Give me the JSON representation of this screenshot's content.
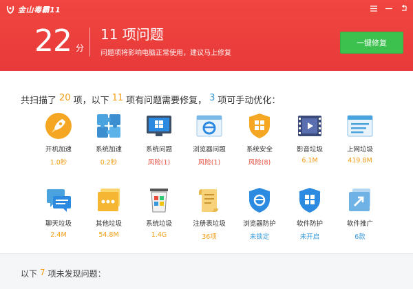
{
  "app": {
    "name": "金山毒霸11"
  },
  "header": {
    "score": "22",
    "score_unit": "分",
    "problem_title": "11 项问题",
    "problem_subtitle": "问题项将影响电脑正常使用，建议马上修复",
    "fix_button": "一键修复"
  },
  "summary": {
    "p1": "共扫描了",
    "scanned": "20",
    "p2": "项，以下",
    "issues": "11",
    "p3": "项有问题需要修复，",
    "manual": "3",
    "p4": "项可手动优化："
  },
  "colors": {
    "risk": "#e74c3c",
    "size": "#f39c12",
    "blue": "#3498db",
    "header": "#ed4040",
    "button": "#3cc14e"
  },
  "items": [
    {
      "label": "开机加速",
      "value": "1.0秒",
      "icon": "rocket-icon",
      "color": "#f39c12"
    },
    {
      "label": "系统加速",
      "value": "0.2秒",
      "icon": "puzzle-icon",
      "color": "#f39c12"
    },
    {
      "label": "系统问题",
      "value": "风险(1)",
      "icon": "windows-monitor-icon",
      "color": "#e74c3c"
    },
    {
      "label": "浏览器问题",
      "value": "风险(1)",
      "icon": "ie-browser-icon",
      "color": "#e74c3c"
    },
    {
      "label": "系统安全",
      "value": "风险(8)",
      "icon": "windows-shield-icon",
      "color": "#e74c3c"
    },
    {
      "label": "影音垃圾",
      "value": "6.1M",
      "icon": "film-icon",
      "color": "#f39c12"
    },
    {
      "label": "上网垃圾",
      "value": "419.8M",
      "icon": "web-page-icon",
      "color": "#f39c12"
    },
    {
      "label": "聊天垃圾",
      "value": "2.4M",
      "icon": "chat-icon",
      "color": "#f39c12"
    },
    {
      "label": "其他垃圾",
      "value": "54.8M",
      "icon": "dots-box-icon",
      "color": "#f39c12"
    },
    {
      "label": "系统垃圾",
      "value": "1.4G",
      "icon": "windows-trash-icon",
      "color": "#f39c12"
    },
    {
      "label": "注册表垃圾",
      "value": "36项",
      "icon": "scroll-icon",
      "color": "#f39c12"
    },
    {
      "label": "浏览器防护",
      "value": "未锁定",
      "icon": "ie-shield-icon",
      "color": "#3498db"
    },
    {
      "label": "软件防护",
      "value": "未开启",
      "icon": "windows-shield-blue-icon",
      "color": "#3498db"
    },
    {
      "label": "软件推广",
      "value": "6款",
      "icon": "share-box-icon",
      "color": "#3498db"
    }
  ],
  "footer": {
    "p1": "以下",
    "count": "7",
    "p2": "项未发现问题："
  }
}
